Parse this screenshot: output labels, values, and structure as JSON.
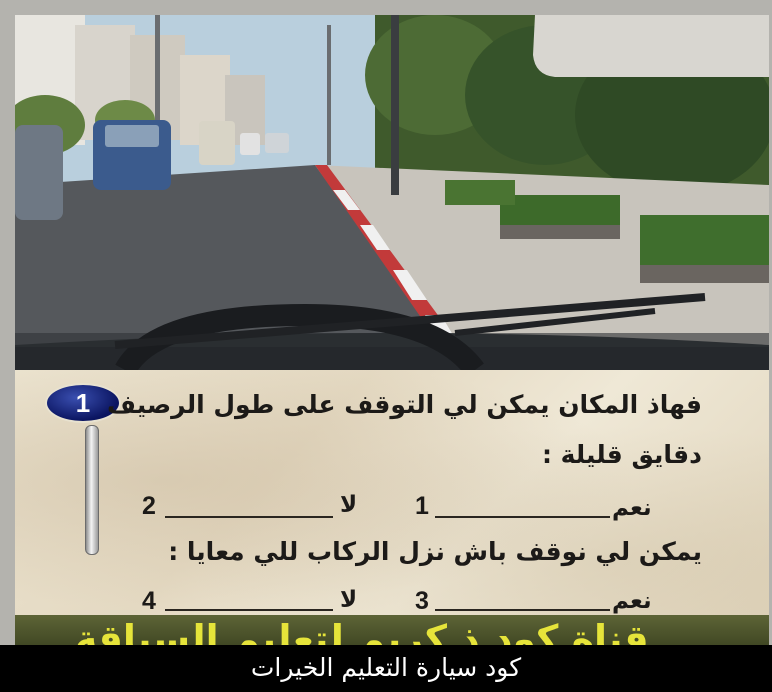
{
  "question": {
    "number": "1",
    "line1": "فهاذ المكان يمكن لي التوقف على طول الرصيف",
    "line2": "دقايق قليلة :",
    "line3": "يمكن لي نوقف باش نزل الركاب للي معايا :"
  },
  "answers": {
    "yes_label": "نعم",
    "no_label": "لا",
    "n1": "1",
    "n2": "2",
    "n3": "3",
    "n4": "4"
  },
  "banner": {
    "text": "قناة كود ذ كريم لتعليم السياقة"
  },
  "caption": {
    "text": "كود سيارة التعليم الخيرات"
  },
  "colors": {
    "badge": "#0a1460",
    "banner_text": "#e6e43a",
    "caption_bg": "#000000"
  }
}
